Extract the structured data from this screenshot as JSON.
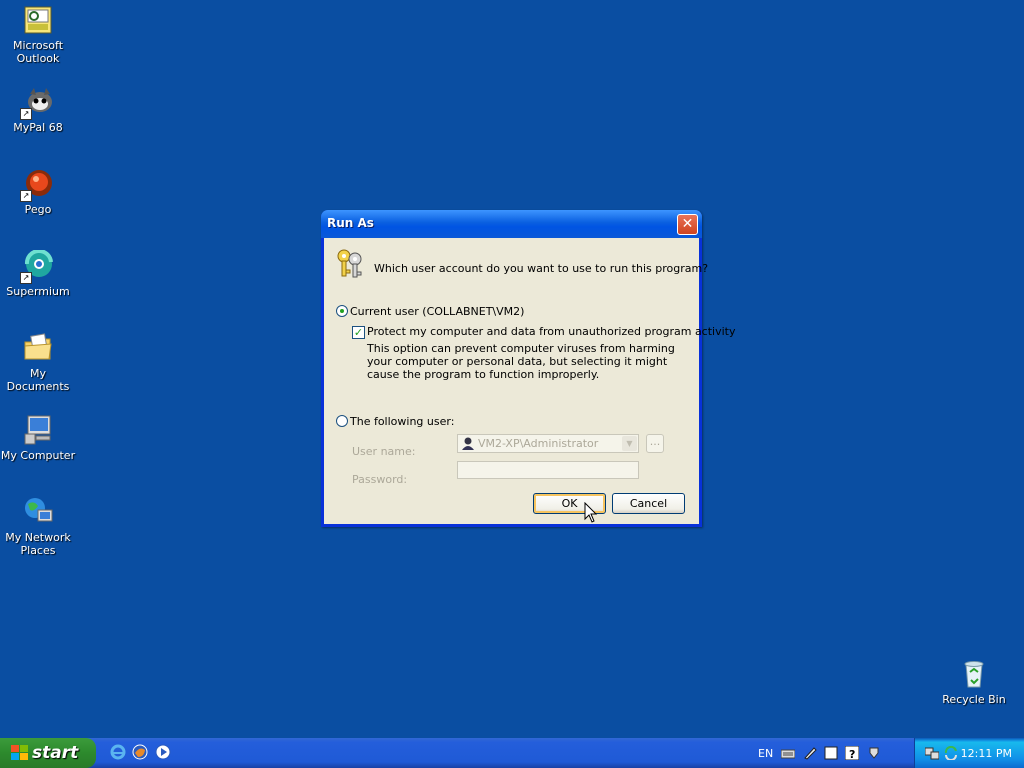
{
  "desktop": {
    "icons": [
      {
        "label": "Microsoft Outlook",
        "icon": "outlook-icon"
      },
      {
        "label": "MyPal 68",
        "icon": "mypal-icon"
      },
      {
        "label": "Pego",
        "icon": "pego-icon"
      },
      {
        "label": "Supermium",
        "icon": "supermium-icon"
      },
      {
        "label": "My Documents",
        "icon": "my-documents-icon"
      },
      {
        "label": "My Computer",
        "icon": "my-computer-icon"
      },
      {
        "label": "My Network Places",
        "icon": "network-places-icon"
      },
      {
        "label": "Recycle Bin",
        "icon": "recycle-bin-icon"
      }
    ],
    "background_color": "#0a4ea2"
  },
  "dialog": {
    "title": "Run As",
    "close_symbol": "✕",
    "question": "Which user account do you want to use to run this program?",
    "current_user_label": "Current user (COLLABNET\\VM2)",
    "current_user_selected": true,
    "protect_label": "Protect my computer and data from unauthorized program activity",
    "protect_checked": true,
    "protect_description": "This option can prevent computer viruses from harming your computer or personal data, but selecting it might cause the program to function improperly.",
    "following_user_label": "The following user:",
    "username_label": "User name:",
    "username_value": "VM2-XP\\Administrator",
    "browse_label": "...",
    "password_label": "Password:",
    "ok_label": "OK",
    "cancel_label": "Cancel"
  },
  "taskbar": {
    "start_label": "start",
    "quick_launch": [
      "internet-explorer-icon",
      "firefox-icon",
      "media-player-icon"
    ],
    "language": "EN",
    "tray_icons": [
      "keyboard-icon",
      "pen-icon",
      "help-icon",
      "safely-remove-icon",
      "network-icon",
      "sync-icon"
    ],
    "clock": "12:11 PM"
  }
}
